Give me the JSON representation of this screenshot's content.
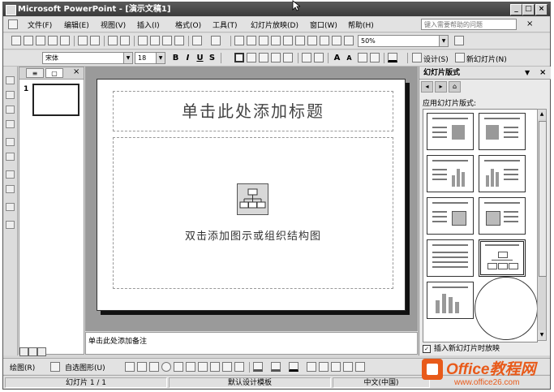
{
  "window": {
    "title": "Microsoft PowerPoint - [演示文稿1]",
    "min": "_",
    "max": "□",
    "close": "×"
  },
  "menubar": {
    "items": [
      "文件(F)",
      "编辑(E)",
      "视图(V)",
      "插入(I)",
      "格式(O)",
      "工具(T)",
      "幻灯片放映(D)",
      "窗口(W)",
      "帮助(H)"
    ],
    "help_placeholder": "键入需要帮助的问题",
    "close": "×"
  },
  "standard_toolbar": {
    "zoom": "50%"
  },
  "format_toolbar": {
    "font": "宋体",
    "size": "18",
    "bold": "B",
    "italic": "I",
    "underline": "U",
    "shadow": "S",
    "grow": "A",
    "shrink": "A",
    "design": "设计(S)",
    "new_slide": "新幻灯片(N)"
  },
  "outline_pane": {
    "close": "×",
    "slide_number": "1"
  },
  "slide": {
    "title_placeholder": "单击此处添加标题",
    "body_placeholder": "双击添加图示或组织结构图"
  },
  "notes": {
    "placeholder": "单击此处添加备注"
  },
  "taskpane": {
    "title": "幻灯片版式",
    "section_label": "应用幻灯片版式:",
    "checkbox_label": "插入新幻灯片时放映",
    "checkbox_checked": "✓",
    "dropdown": "▼",
    "close": "×"
  },
  "drawbar": {
    "draw": "绘图(R)",
    "autoshapes": "自选图形(U)"
  },
  "statusbar": {
    "slide": "幻灯片 1 / 1",
    "template": "默认设计模板",
    "language": "中文(中国)"
  },
  "watermark": {
    "brand": "Office教程网",
    "url": "www.office26.com"
  }
}
